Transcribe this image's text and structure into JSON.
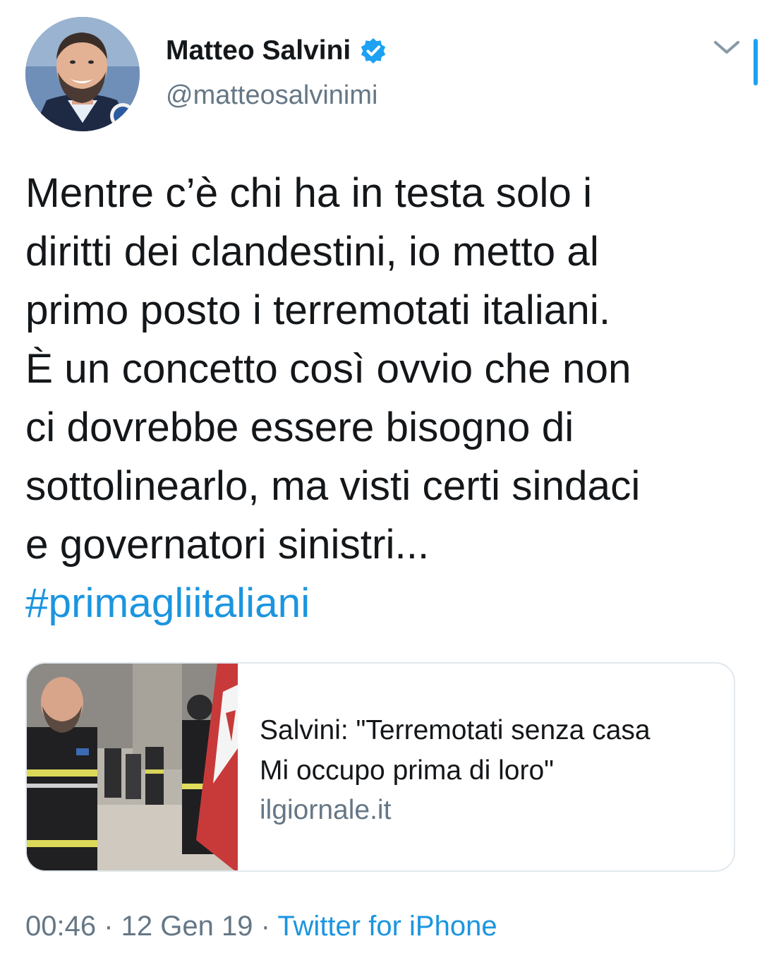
{
  "author": {
    "display_name": "Matteo Salvini",
    "handle": "@matteosalvinimi",
    "verified_icon": "verified-badge-icon",
    "avatar": "profile-photo"
  },
  "tweet": {
    "text_lines": [
      "Mentre c’è chi ha in testa solo i",
      "diritti dei clandestini, io metto al",
      "primo posto i terremotati italiani.",
      "È un concetto così ovvio che non",
      "ci dovrebbe essere bisogno di",
      "sottolinearlo, ma visti certi sindaci",
      "e governatori sinistri..."
    ],
    "hashtag": "#primagliitaliani"
  },
  "card": {
    "title_lines": [
      "Salvini: \"Terremotati senza casa",
      "Mi occupo prima di loro\""
    ],
    "domain": "ilgiornale.it",
    "image": "news-photo"
  },
  "meta": {
    "time": "00:46",
    "separator": " · ",
    "date": "12 Gen 19",
    "source": "Twitter for iPhone"
  },
  "colors": {
    "link": "#1b95e0",
    "secondary": "#657786",
    "text": "#14171a",
    "verified": "#1da1f2",
    "border": "#e1e8ed"
  },
  "icons": {
    "menu": "chevron-down-icon"
  }
}
